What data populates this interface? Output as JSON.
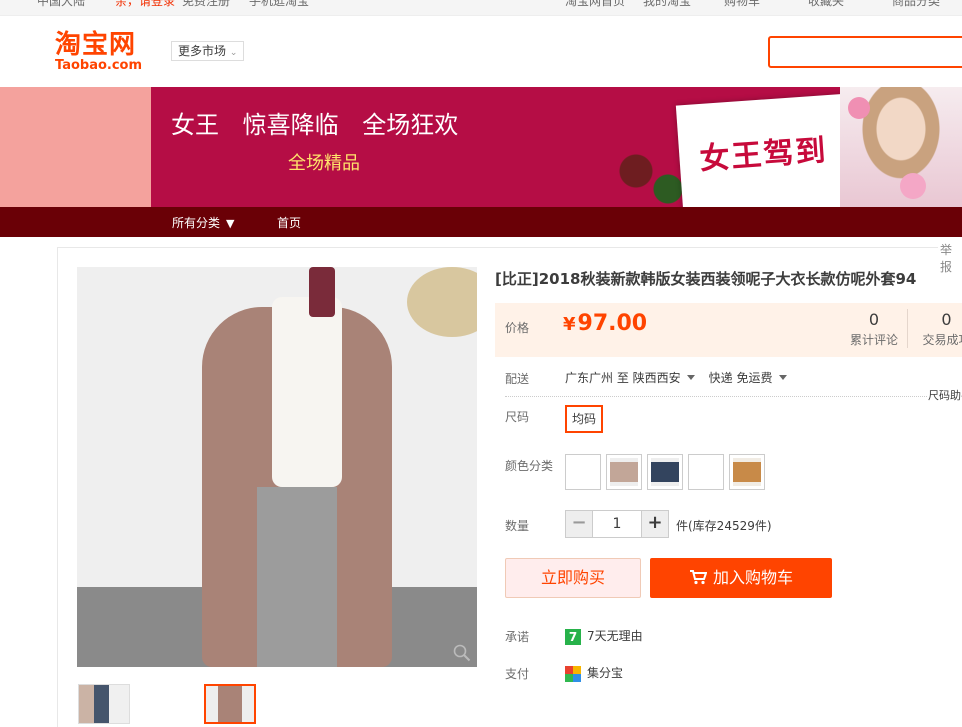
{
  "topbar": {
    "region": "中国大陆",
    "login": "亲，请登录",
    "register": "免费注册",
    "mobile": "手机逛淘宝",
    "taobao_home": "淘宝网首页",
    "my_taobao": "我的淘宝",
    "cart": "购物车",
    "favorites": "收藏夹",
    "categories": "商品分类"
  },
  "header": {
    "logo_cn": "淘宝网",
    "logo_en": "Taobao.com",
    "more_market": "更多市场",
    "search_placeholder": ""
  },
  "banner": {
    "slogan": "女王 惊喜降临 全场狂欢",
    "sub": "全场精品",
    "card_text": "女王驾到"
  },
  "catbar": {
    "all_categories": "所有分类",
    "home": "首页"
  },
  "report": "举报",
  "product": {
    "title": "[比正]2018秋装新款韩版女装西装领呢子大衣长款仿呢外套94",
    "price_label": "价格",
    "currency": "¥",
    "price": "97.00",
    "reviews_count": "0",
    "reviews_label": "累计评论",
    "sales_count": "0",
    "sales_label": "交易成功",
    "shipping_label": "配送",
    "ship_from": "广东广州 至",
    "ship_to": "陕西西安",
    "ship_method": "快递 免运费",
    "side_tag": "尺码助手",
    "size_label": "尺码",
    "size_value": "均码",
    "color_label": "颜色分类",
    "qty_label": "数量",
    "qty_value": "1",
    "stock": "件(库存24529件)",
    "buy_now": "立即购买",
    "add_to_cart": "加入购物车",
    "promise_label": "承诺",
    "promise_badge": "7",
    "promise_text": "7天无理由",
    "pay_label": "支付",
    "pay_text": "集分宝"
  },
  "colors": {
    "brand": "#ff4400",
    "banner": "#b50d45",
    "catbar": "#6a0006"
  }
}
